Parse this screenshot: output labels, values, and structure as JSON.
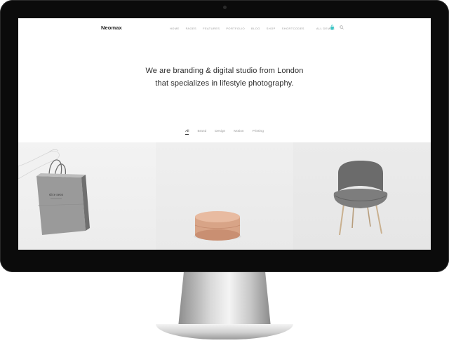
{
  "site": {
    "logo": "Neomax",
    "nav": [
      "HOME",
      "PAGES",
      "FEATURES",
      "PORTFOLIO",
      "BLOG",
      "SHOP",
      "SHORTCODES",
      "ALL DEMOS"
    ],
    "accent_color": "#3cc6c6"
  },
  "hero": {
    "line1": "We are branding & digital studio from London",
    "line2": "that specializes in lifestyle photography."
  },
  "filters": [
    "All",
    "Brand",
    "Design",
    "Motion",
    "Printing"
  ],
  "portfolio": {
    "items": [
      {
        "image": "shopping-bag-image",
        "brand_text": "slice neon"
      },
      {
        "image": "wooden-box-image"
      },
      {
        "image": "chair-image"
      }
    ]
  }
}
